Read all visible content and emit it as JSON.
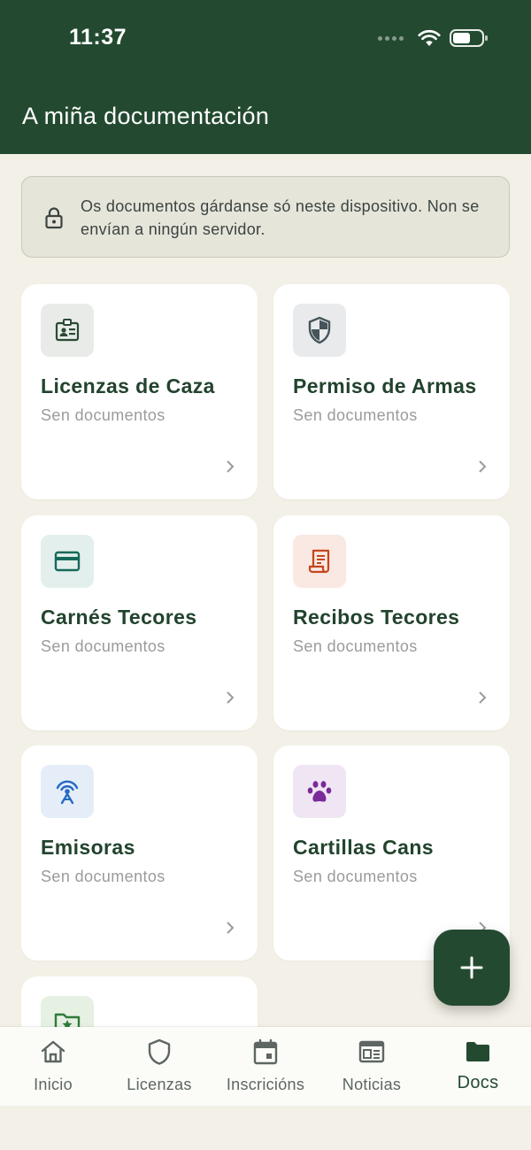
{
  "status_bar": {
    "time": "11:37"
  },
  "header": {
    "title": "A miña documentación"
  },
  "notice": {
    "text": "Os documentos gárdanse só neste dispositivo. Non se envían a ningún servidor."
  },
  "cards": [
    {
      "title": "Licenzas de Caza",
      "subtitle": "Sen documentos",
      "icon": "id-badge-icon",
      "tile_color": "#e9ebe9",
      "icon_color": "#2b4a34"
    },
    {
      "title": "Permiso de Armas",
      "subtitle": "Sen documentos",
      "icon": "shield-icon",
      "tile_color": "#e8eaec",
      "icon_color": "#46535a"
    },
    {
      "title": "Carnés Tecores",
      "subtitle": "Sen documentos",
      "icon": "card-icon",
      "tile_color": "#e3efec",
      "icon_color": "#16695a"
    },
    {
      "title": "Recibos Tecores",
      "subtitle": "Sen documentos",
      "icon": "receipt-icon",
      "tile_color": "#fae8e2",
      "icon_color": "#c4461e"
    },
    {
      "title": "Emisoras",
      "subtitle": "Sen documentos",
      "icon": "radio-icon",
      "tile_color": "#e5eef8",
      "icon_color": "#2768c4"
    },
    {
      "title": "Cartillas Cans",
      "subtitle": "Sen documentos",
      "icon": "paw-icon",
      "tile_color": "#efe5f3",
      "icon_color": "#7a2a9a"
    },
    {
      "title": "",
      "subtitle": "",
      "icon": "folder-star-icon",
      "tile_color": "#e6f0e3",
      "icon_color": "#2f7a3a"
    }
  ],
  "nav": {
    "items": [
      {
        "label": "Inicio",
        "icon": "home-icon"
      },
      {
        "label": "Licenzas",
        "icon": "shield-outline-icon"
      },
      {
        "label": "Inscricións",
        "icon": "calendar-icon"
      },
      {
        "label": "Noticias",
        "icon": "newspaper-icon"
      },
      {
        "label": "Docs",
        "icon": "folder-icon",
        "active": true
      }
    ]
  },
  "colors": {
    "primary": "#234a30",
    "background": "#f3f1e7",
    "card": "#ffffff"
  }
}
